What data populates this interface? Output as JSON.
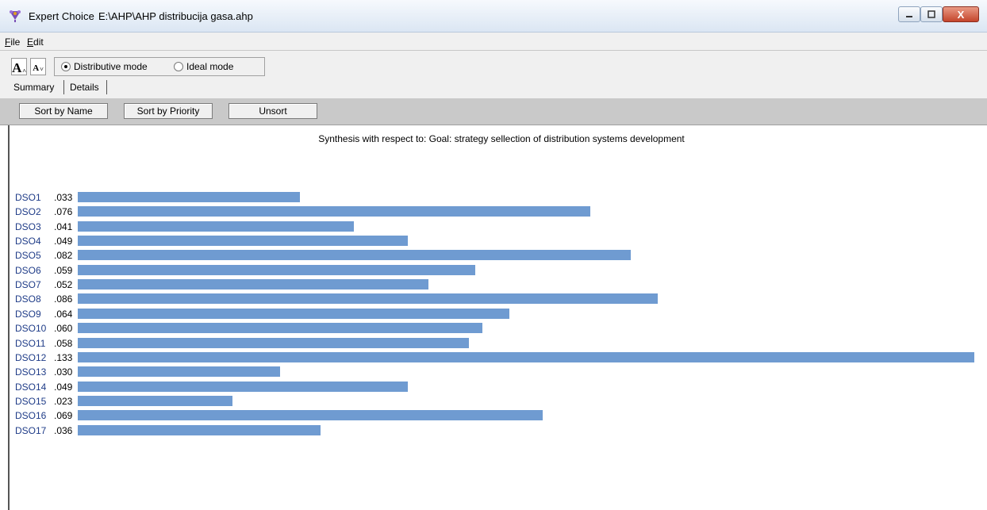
{
  "window": {
    "app_name": "Expert Choice",
    "file_path": "E:\\AHP\\AHP distribucija gasa.ahp",
    "close_glyph": "X"
  },
  "menu": [
    {
      "label": "File",
      "mnemonic": "F"
    },
    {
      "label": "Edit",
      "mnemonic": "E"
    }
  ],
  "toolbar": {
    "font_large": "A",
    "font_small": "A",
    "modes": [
      {
        "label": "Distributive mode",
        "selected": true
      },
      {
        "label": "Ideal mode",
        "selected": false
      }
    ]
  },
  "tabs": [
    "Summary",
    "Details"
  ],
  "sort_buttons": [
    "Sort by Name",
    "Sort by Priority",
    "Unsort"
  ],
  "synthesis_title": "Synthesis with respect to: Goal: strategy sellection of distribution systems development",
  "colors": {
    "bar": "#6f9bd1",
    "label": "#1f3c88"
  },
  "priorities": [
    {
      "name": "DSO1",
      "value": ".033"
    },
    {
      "name": "DSO2",
      "value": ".076"
    },
    {
      "name": "DSO3",
      "value": ".041"
    },
    {
      "name": "DSO4",
      "value": ".049"
    },
    {
      "name": "DSO5",
      "value": ".082"
    },
    {
      "name": "DSO6",
      "value": ".059"
    },
    {
      "name": "DSO7",
      "value": ".052"
    },
    {
      "name": "DSO8",
      "value": ".086"
    },
    {
      "name": "DSO9",
      "value": ".064"
    },
    {
      "name": "DSO10",
      "value": ".060"
    },
    {
      "name": "DSO11",
      "value": ".058"
    },
    {
      "name": "DSO12",
      "value": ".133"
    },
    {
      "name": "DSO13",
      "value": ".030"
    },
    {
      "name": "DSO14",
      "value": ".049"
    },
    {
      "name": "DSO15",
      "value": ".023"
    },
    {
      "name": "DSO16",
      "value": ".069"
    },
    {
      "name": "DSO17",
      "value": ".036"
    }
  ]
}
